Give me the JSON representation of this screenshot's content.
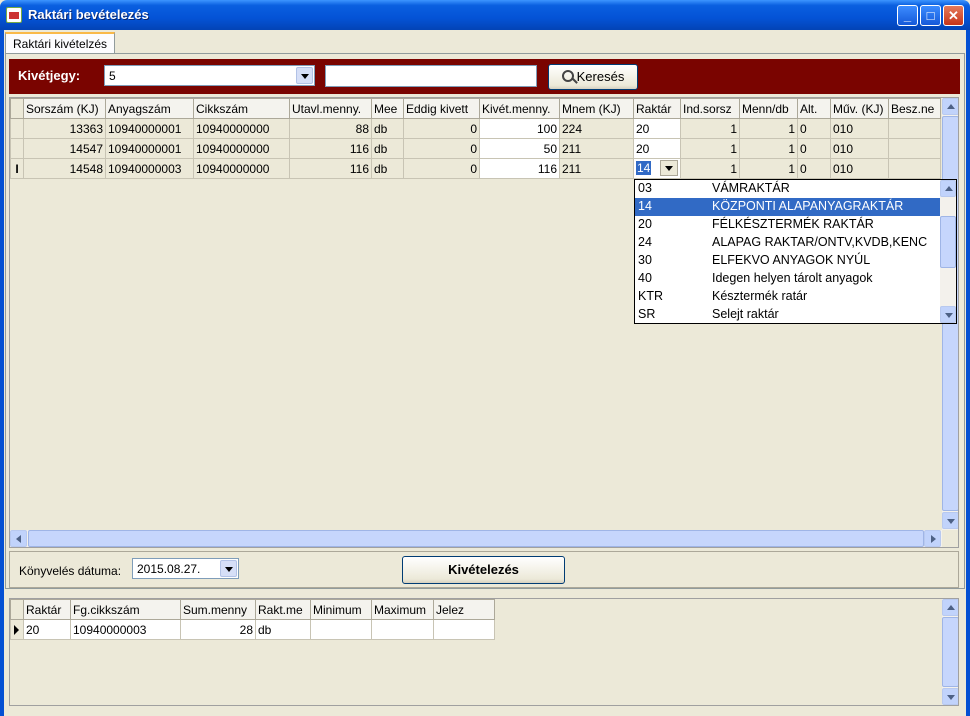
{
  "window": {
    "title": "Raktári bevételezés",
    "min": "_",
    "max": "□",
    "close": "✕"
  },
  "tab": {
    "label": "Raktári kivételzés"
  },
  "searchbar": {
    "label": "Kivétjegy:",
    "ticket_value": "5",
    "search_text": "",
    "search_button": "Keresés"
  },
  "main_grid": {
    "columns": [
      "Sorszám (KJ)",
      "Anyagszám",
      "Cikkszám",
      "Utavl.menny.",
      "Mee",
      "Eddig kivett",
      "Kivét.menny.",
      "Mnem (KJ)",
      "Raktár",
      "Ind.sorsz",
      "Menn/db",
      "Alt.",
      "Műv. (KJ)",
      "Besz.ne"
    ],
    "rows": [
      {
        "marker": "",
        "sorszam": "13363",
        "anyagszam": "10940000001",
        "cikkszam": "10940000000",
        "utavl": "88",
        "mee": "db",
        "eddig": "0",
        "kivet": "100",
        "mnem": "224",
        "raktar": "20",
        "ind": "1",
        "menn": "1",
        "alt": "0",
        "muv": "010",
        "besz": ""
      },
      {
        "marker": "",
        "sorszam": "14547",
        "anyagszam": "10940000001",
        "cikkszam": "10940000000",
        "utavl": "116",
        "mee": "db",
        "eddig": "0",
        "kivet": "50",
        "mnem": "211",
        "raktar": "20",
        "ind": "1",
        "menn": "1",
        "alt": "0",
        "muv": "010",
        "besz": ""
      },
      {
        "marker": "I",
        "sorszam": "14548",
        "anyagszam": "10940000003",
        "cikkszam": "10940000000",
        "utavl": "116",
        "mee": "db",
        "eddig": "0",
        "kivet": "116",
        "mnem": "211",
        "raktar": "14",
        "ind": "1",
        "menn": "1",
        "alt": "0",
        "muv": "010",
        "besz": ""
      }
    ]
  },
  "raktar_dropdown": [
    {
      "code": "03",
      "name": "VÁMRAKTÁR",
      "selected": false
    },
    {
      "code": "14",
      "name": "KÖZPONTI ALAPANYAGRAKTÁR",
      "selected": true
    },
    {
      "code": "20",
      "name": "FÉLKÉSZTERMÉK RAKTÁR",
      "selected": false
    },
    {
      "code": "24",
      "name": "ALAPAG RAKTAR/ONTV,KVDB,KENC",
      "selected": false
    },
    {
      "code": "30",
      "name": "ELFEKVO ANYAGOK NYÚL",
      "selected": false
    },
    {
      "code": "40",
      "name": "Idegen helyen tárolt anyagok",
      "selected": false
    },
    {
      "code": "KTR",
      "name": "Késztermék ratár",
      "selected": false
    },
    {
      "code": "SR",
      "name": "Selejt raktár",
      "selected": false
    }
  ],
  "booking": {
    "label": "Könyvelés dátuma:",
    "date": "2015.08.27.",
    "button": "Kivételezés"
  },
  "summary_grid": {
    "columns": [
      "Raktár",
      "Fg.cikkszám",
      "Sum.menny",
      "Rakt.me",
      "Minimum",
      "Maximum",
      "Jelez"
    ],
    "rows": [
      {
        "raktar": "20",
        "fg": "10940000003",
        "sum": "28",
        "raktme": "db",
        "min": "",
        "max": "",
        "jelez": ""
      }
    ]
  }
}
